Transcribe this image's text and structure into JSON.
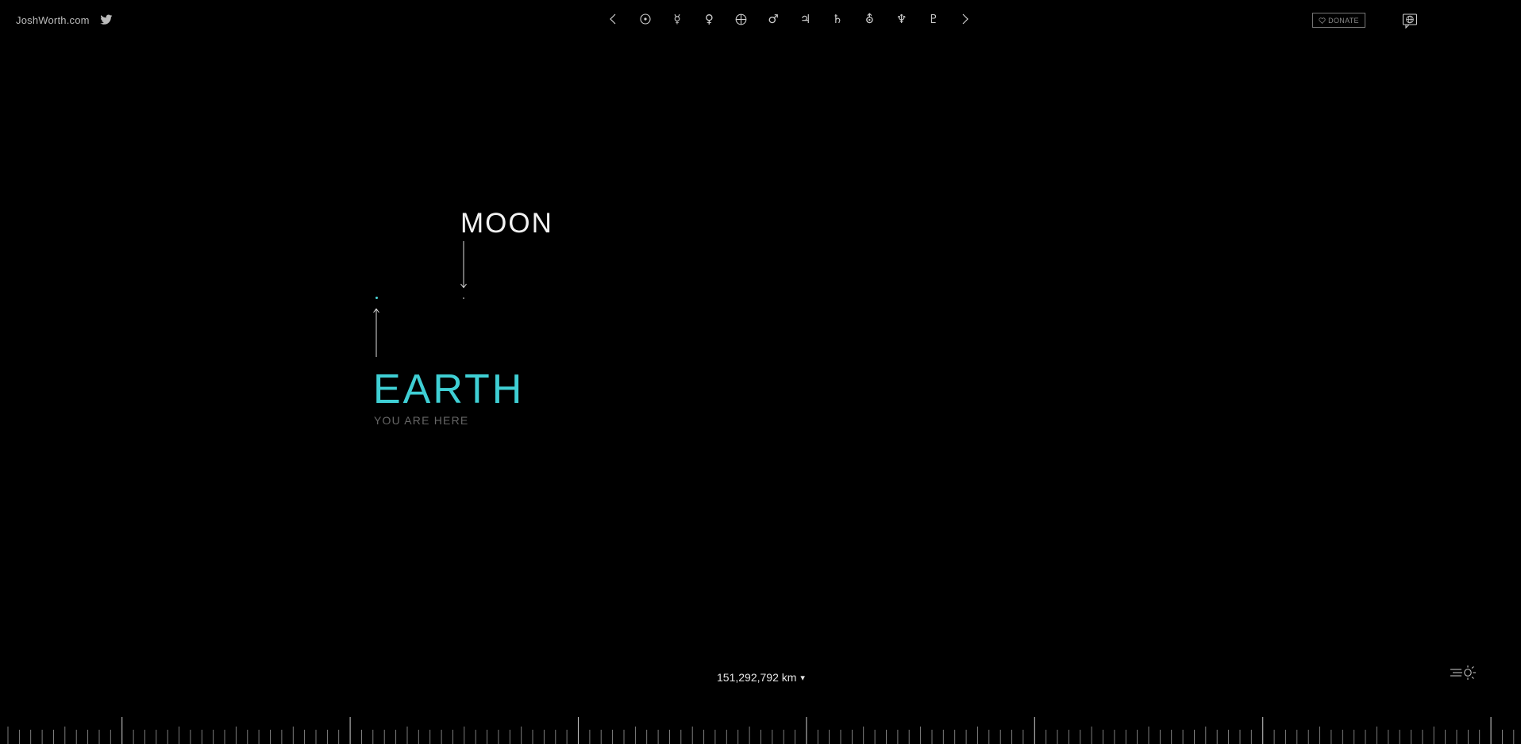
{
  "header": {
    "site_name": "JoshWorth.com",
    "twitter_icon": "twitter-bird-icon",
    "donate_label": "DONATE",
    "donate_icon": "heart-icon",
    "language_icon": "globe-speech-icon"
  },
  "planet_nav": {
    "prev_glyph": "‹",
    "next_glyph": "›",
    "items": [
      {
        "name": "Sun",
        "icon": "sun-icon"
      },
      {
        "name": "Mercury",
        "glyph": "☿",
        "icon": "mercury-icon"
      },
      {
        "name": "Venus",
        "glyph": "♀",
        "icon": "venus-icon"
      },
      {
        "name": "Earth",
        "icon": "earth-icon"
      },
      {
        "name": "Mars",
        "glyph": "♂",
        "icon": "mars-icon"
      },
      {
        "name": "Jupiter",
        "glyph": "♃",
        "icon": "jupiter-icon"
      },
      {
        "name": "Saturn",
        "glyph": "♄",
        "icon": "saturn-icon"
      },
      {
        "name": "Uranus",
        "glyph": "⛢",
        "icon": "uranus-icon"
      },
      {
        "name": "Neptune",
        "glyph": "♆",
        "icon": "neptune-icon"
      },
      {
        "name": "Pluto",
        "glyph": "♇",
        "icon": "pluto-icon"
      }
    ]
  },
  "scene": {
    "moon_label": "MOON",
    "earth_label": "EARTH",
    "earth_sublabel": "YOU ARE HERE"
  },
  "footer": {
    "distance": "151,292,792 km",
    "distance_dropdown_glyph": "▾",
    "speed_icon": "speed-of-light-icon"
  },
  "colors": {
    "background": "#000000",
    "accent": "#3fcfd4",
    "text": "#e6e6e6",
    "muted": "#666666"
  }
}
